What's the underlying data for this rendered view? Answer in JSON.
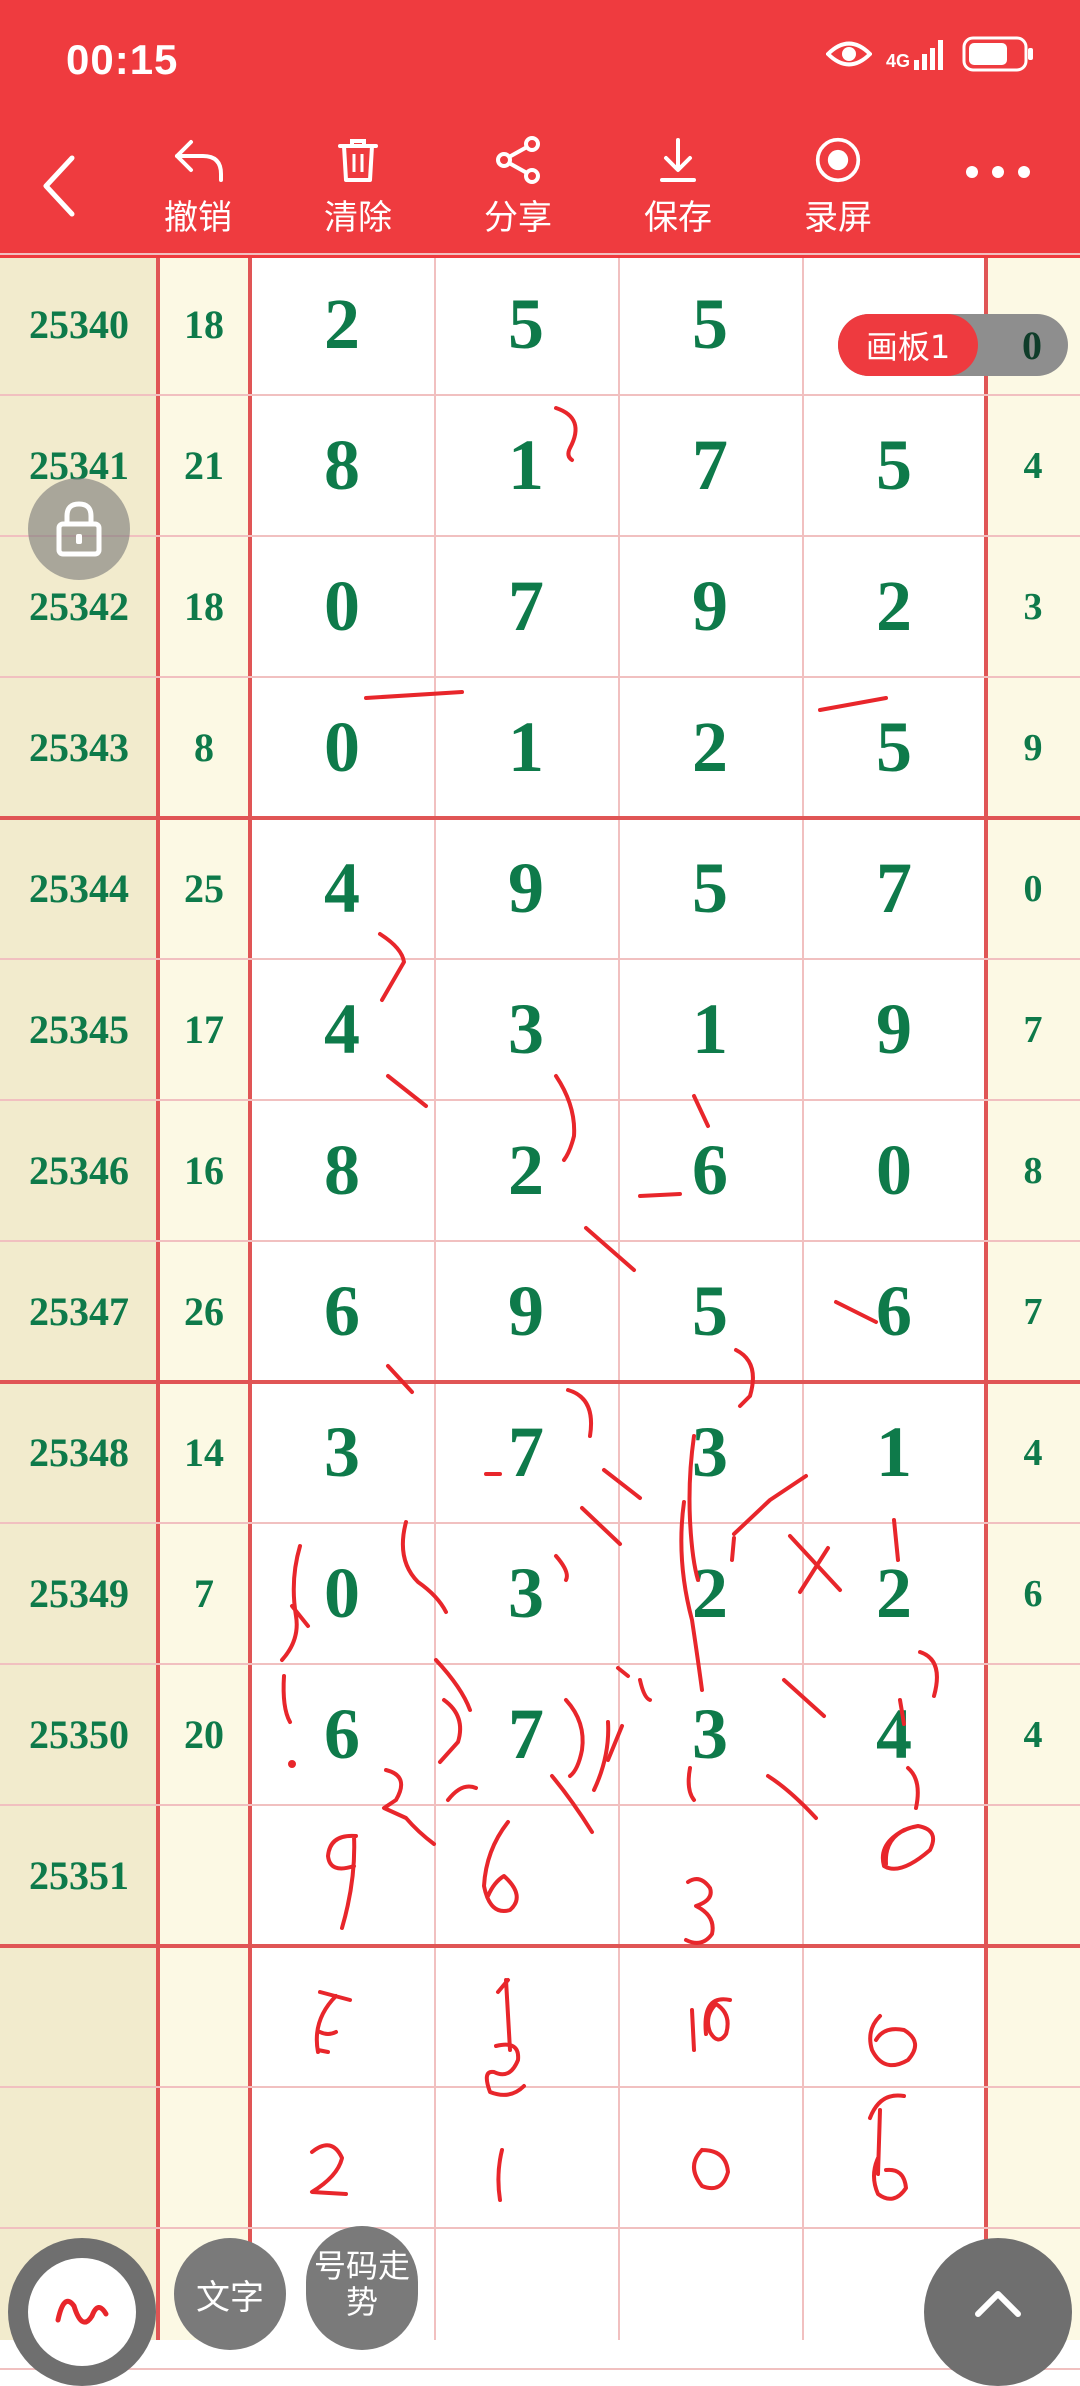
{
  "status": {
    "time": "00:15",
    "network": "4G"
  },
  "toolbar": {
    "undo": "撤销",
    "clear": "清除",
    "share": "分享",
    "save": "保存",
    "record": "录屏"
  },
  "board": {
    "label": "画板1",
    "value": "0"
  },
  "rows": [
    {
      "issue": "25340",
      "sum": "18",
      "digits": [
        "2",
        "5",
        "5",
        ""
      ],
      "tail": ""
    },
    {
      "issue": "25341",
      "sum": "21",
      "digits": [
        "8",
        "1",
        "7",
        "5"
      ],
      "tail": "4"
    },
    {
      "issue": "25342",
      "sum": "18",
      "digits": [
        "0",
        "7",
        "9",
        "2"
      ],
      "tail": "3"
    },
    {
      "issue": "25343",
      "sum": "8",
      "digits": [
        "0",
        "1",
        "2",
        "5"
      ],
      "tail": "9"
    },
    {
      "issue": "25344",
      "sum": "25",
      "digits": [
        "4",
        "9",
        "5",
        "7"
      ],
      "tail": "0"
    },
    {
      "issue": "25345",
      "sum": "17",
      "digits": [
        "4",
        "3",
        "1",
        "9"
      ],
      "tail": "7"
    },
    {
      "issue": "25346",
      "sum": "16",
      "digits": [
        "8",
        "2",
        "6",
        "0"
      ],
      "tail": "8"
    },
    {
      "issue": "25347",
      "sum": "26",
      "digits": [
        "6",
        "9",
        "5",
        "6"
      ],
      "tail": "7"
    },
    {
      "issue": "25348",
      "sum": "14",
      "digits": [
        "3",
        "7",
        "3",
        "1"
      ],
      "tail": "4"
    },
    {
      "issue": "25349",
      "sum": "7",
      "digits": [
        "0",
        "3",
        "2",
        "2"
      ],
      "tail": "6"
    },
    {
      "issue": "25350",
      "sum": "20",
      "digits": [
        "6",
        "7",
        "3",
        "4"
      ],
      "tail": "4"
    },
    {
      "issue": "25351",
      "sum": "",
      "digits": [
        "",
        "",
        "",
        ""
      ],
      "tail": ""
    }
  ],
  "fabs": {
    "text": "文字",
    "trend": "号码走势"
  },
  "colors": {
    "bar": "#ef3b3f",
    "digit": "#0e7a4a",
    "ink": "#e8262b",
    "gridline": "#f1c0c0"
  }
}
